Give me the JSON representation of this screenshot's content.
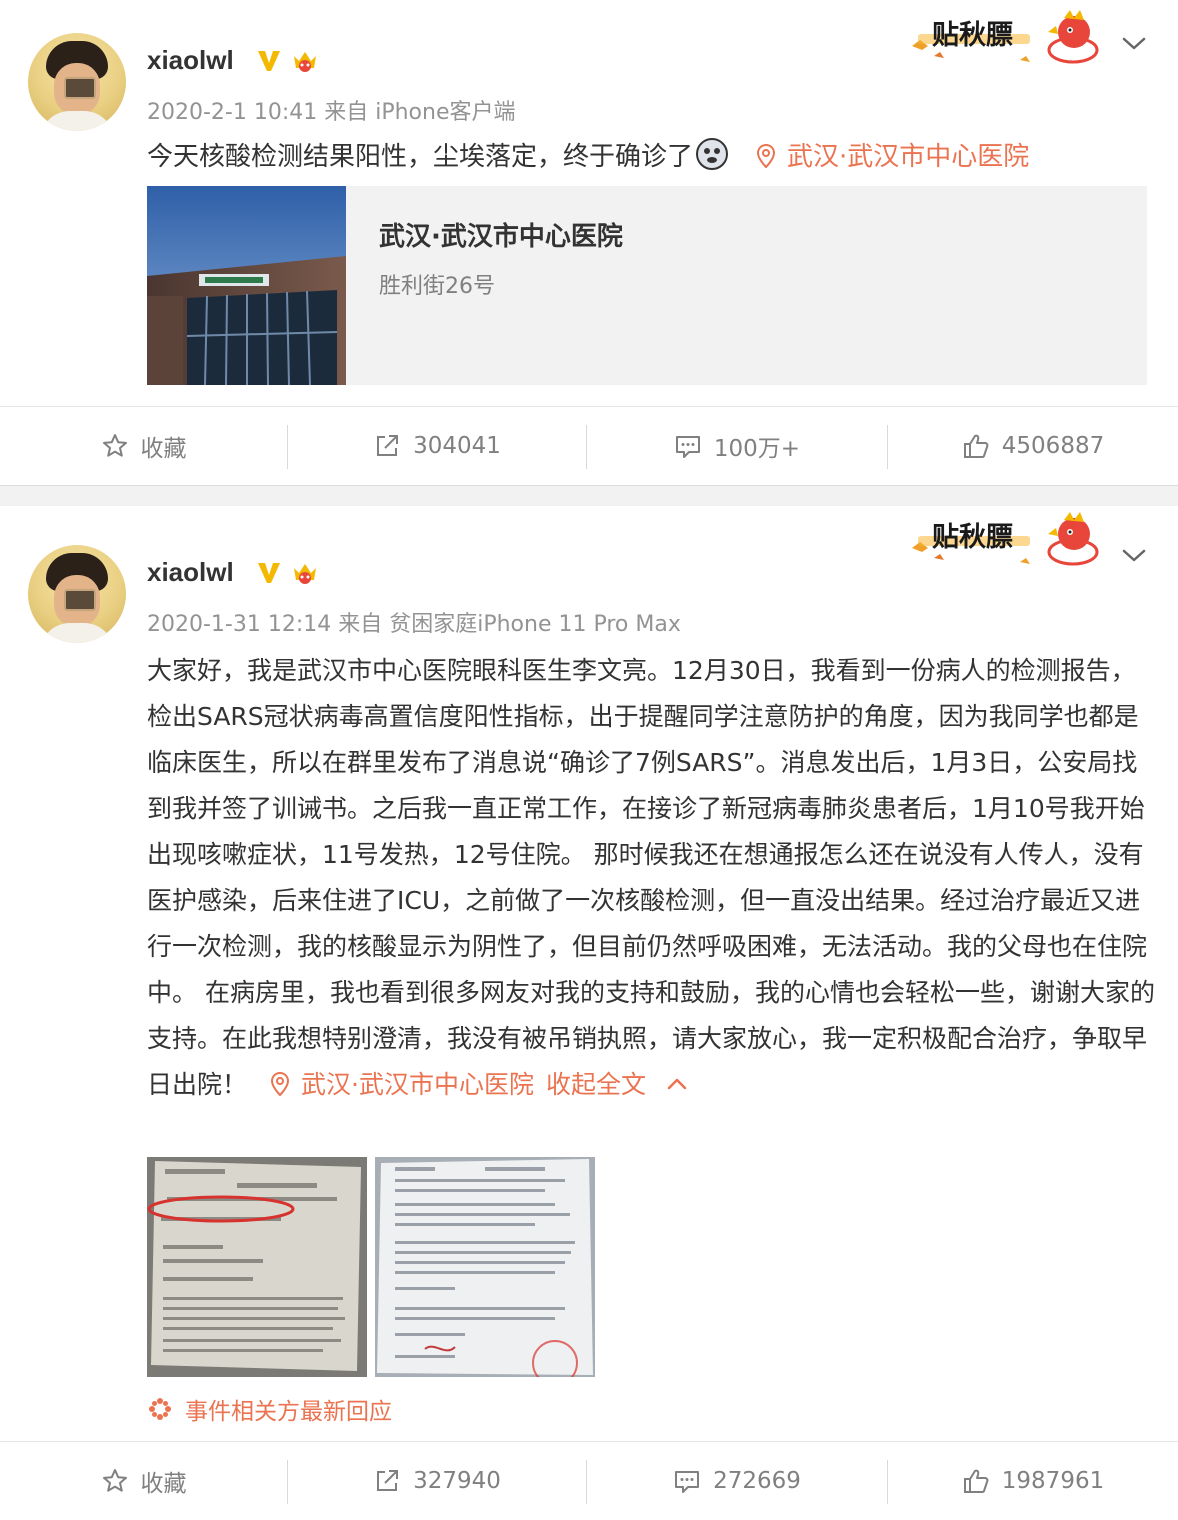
{
  "posts": [
    {
      "username": "xiaolwl",
      "meta": "2020-2-1 10:41 来自 iPhone客户端",
      "deco_text": "贴秋膘",
      "text": "今天核酸检测结果阳性，尘埃落定，终于确诊了",
      "location": "武汉·武汉市中心医院",
      "card": {
        "title": "武汉·武汉市中心医院",
        "address": "胜利街26号"
      },
      "actions": {
        "favorite": "收藏",
        "repost": "304041",
        "comment": "100万+",
        "like": "4506887"
      }
    },
    {
      "username": "xiaolwl",
      "meta": "2020-1-31 12:14 来自 贫困家庭iPhone 11 Pro Max",
      "deco_text": "贴秋膘",
      "text": "大家好，我是武汉市中心医院眼科医生李文亮。12月30日，我看到一份病人的检测报告，检出SARS冠状病毒高置信度阳性指标，出于提醒同学注意防护的角度，因为我同学也都是临床医生，所以在群里发布了消息说“确诊了7例SARS”。消息发出后，1月3日，公安局找到我并签了训诫书。之后我一直正常工作，在接诊了新冠病毒肺炎患者后，1月10号我开始出现咳嗽症状，11号发热，12号住院。 那时候我还在想通报怎么还在说没有人传人，没有医护感染，后来住进了ICU，之前做了一次核酸检测，但一直没出结果。经过治疗最近又进行一次检测，我的核酸显示为阴性了，但目前仍然呼吸困难，无法活动。我的父母也在住院中。 在病房里，我也看到很多网友对我的支持和鼓励，我的心情也会轻松一些，谢谢大家的支持。在此我想特别澄清，我没有被吊销执照，请大家放心，我一定积极配合治疗，争取早日出院！",
      "location": "武汉·武汉市中心医院",
      "collapse_label": "收起全文",
      "related_label": "事件相关方最新回应",
      "actions": {
        "favorite": "收藏",
        "repost": "327940",
        "comment": "272669",
        "like": "1987961"
      }
    }
  ],
  "colors": {
    "accent": "#eb7350",
    "verified": "#f5b800",
    "muted": "#939393",
    "divider": "#f2f2f2"
  },
  "icons": [
    "star-icon",
    "share-icon",
    "comment-icon",
    "thumbs-up-icon",
    "location-pin-icon",
    "verified-v-icon",
    "crown-badge-icon",
    "chevron-down-icon",
    "chevron-up-icon",
    "flower-icon"
  ]
}
